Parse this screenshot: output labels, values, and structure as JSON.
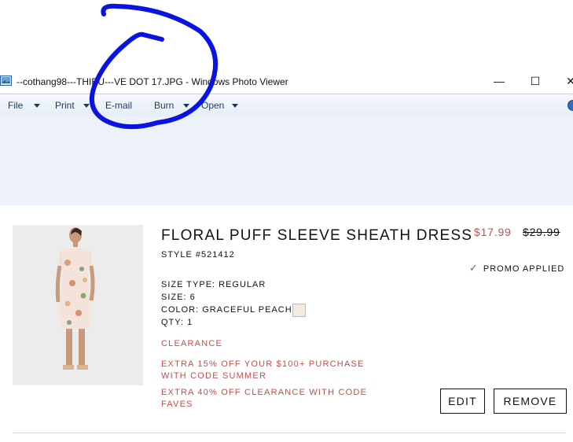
{
  "window": {
    "title": "--cothang98---THIEU---VE DOT 17.JPG - Windows Photo Viewer",
    "minimize": "—",
    "maximize": "☐",
    "close": "✕"
  },
  "menu": {
    "file": "File",
    "print": "Print",
    "email": "E-mail",
    "burn": "Burn",
    "open": "Open"
  },
  "product": {
    "title": "FLORAL PUFF SLEEVE SHEATH DRESS",
    "style": "STYLE #521412",
    "sale_price": "$17.99",
    "original_price": "$29.99",
    "promo_check": "✓",
    "promo": "PROMO APPLIED",
    "size_type_label": "SIZE TYPE:",
    "size_type": "REGULAR",
    "size_label": "SIZE:",
    "size": "6",
    "color_label": "COLOR:",
    "color": "GRACEFUL PEACH",
    "qty_label": "QTY:",
    "qty": "1",
    "clearance": "CLEARANCE",
    "offer1_line1": "EXTRA 15% OFF YOUR $100+ PURCHASE",
    "offer1_line2": "WITH CODE SUMMER",
    "offer2_line1": "EXTRA 40% OFF CLEARANCE WITH CODE",
    "offer2_line2": "FAVES",
    "edit": "EDIT",
    "remove": "REMOVE"
  },
  "colors": {
    "accent_red": "#c0504d",
    "scribble": "#0a14e0",
    "swatch": "#f4ebe0"
  }
}
